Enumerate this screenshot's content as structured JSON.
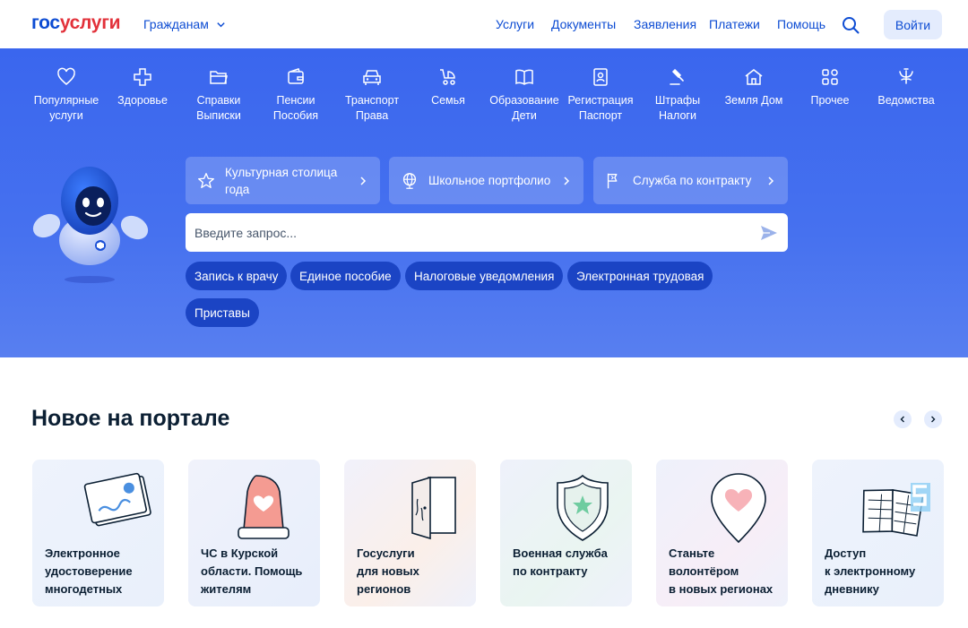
{
  "header": {
    "logo_part1": "гос",
    "logo_part2": "услуги",
    "audience": "Гражданам",
    "nav": [
      "Услуги",
      "Документы",
      "Заявления",
      "Платежи",
      "Помощь"
    ],
    "login": "Войти",
    "icons": {
      "audience": "chevron-down-icon",
      "search": "search-icon"
    }
  },
  "categories": [
    {
      "line1": "Популярные",
      "line2": "услуги",
      "icon": "heart-icon"
    },
    {
      "line1": "Здоровье",
      "line2": "",
      "icon": "cross-icon"
    },
    {
      "line1": "Справки",
      "line2": "Выписки",
      "icon": "folder-icon"
    },
    {
      "line1": "Пенсии",
      "line2": "Пособия",
      "icon": "wallet-icon"
    },
    {
      "line1": "Транспорт",
      "line2": "Права",
      "icon": "car-icon"
    },
    {
      "line1": "Семья",
      "line2": "",
      "icon": "stroller-icon"
    },
    {
      "line1": "Образование",
      "line2": "Дети",
      "icon": "book-icon"
    },
    {
      "line1": "Регистрация",
      "line2": "Паспорт",
      "icon": "id-card-icon"
    },
    {
      "line1": "Штрафы",
      "line2": "Налоги",
      "icon": "gavel-icon"
    },
    {
      "line1": "Земля Дом",
      "line2": "",
      "icon": "house-icon"
    },
    {
      "line1": "Прочее",
      "line2": "",
      "icon": "grid-icon"
    },
    {
      "line1": "Ведомства",
      "line2": "",
      "icon": "eagle-icon"
    }
  ],
  "promos": [
    {
      "label": "Культурная столица года",
      "icon": "star-icon"
    },
    {
      "label": "Школьное портфолио",
      "icon": "globe-icon"
    },
    {
      "label": "Служба по контракту",
      "icon": "flag-icon"
    }
  ],
  "search": {
    "placeholder": "Введите запрос...",
    "icon": "send-icon"
  },
  "quick_links": [
    "Запись к врачу",
    "Единое пособие",
    "Налоговые уведомления",
    "Электронная трудовая",
    "Приставы"
  ],
  "news": {
    "title": "Новое на портале",
    "cards": [
      {
        "l1": "Электронное",
        "l2": "удостоверение",
        "l3": "многодетных"
      },
      {
        "l1": "ЧС в Курской",
        "l2": "области. Помощь",
        "l3": "жителям"
      },
      {
        "l1": "Госуслуги",
        "l2": "для новых",
        "l3": "регионов"
      },
      {
        "l1": "Военная служба",
        "l2": "по контракту",
        "l3": ""
      },
      {
        "l1": "Станьте",
        "l2": "волонтёром",
        "l3": "в новых регионах"
      },
      {
        "l1": "Доступ",
        "l2": "к электронному",
        "l3": "дневнику"
      }
    ]
  },
  "colors": {
    "brand_blue": "#0d4cd3",
    "brand_red": "#e2313a",
    "hero": "#4671ef",
    "chip": "#1b44c4"
  }
}
